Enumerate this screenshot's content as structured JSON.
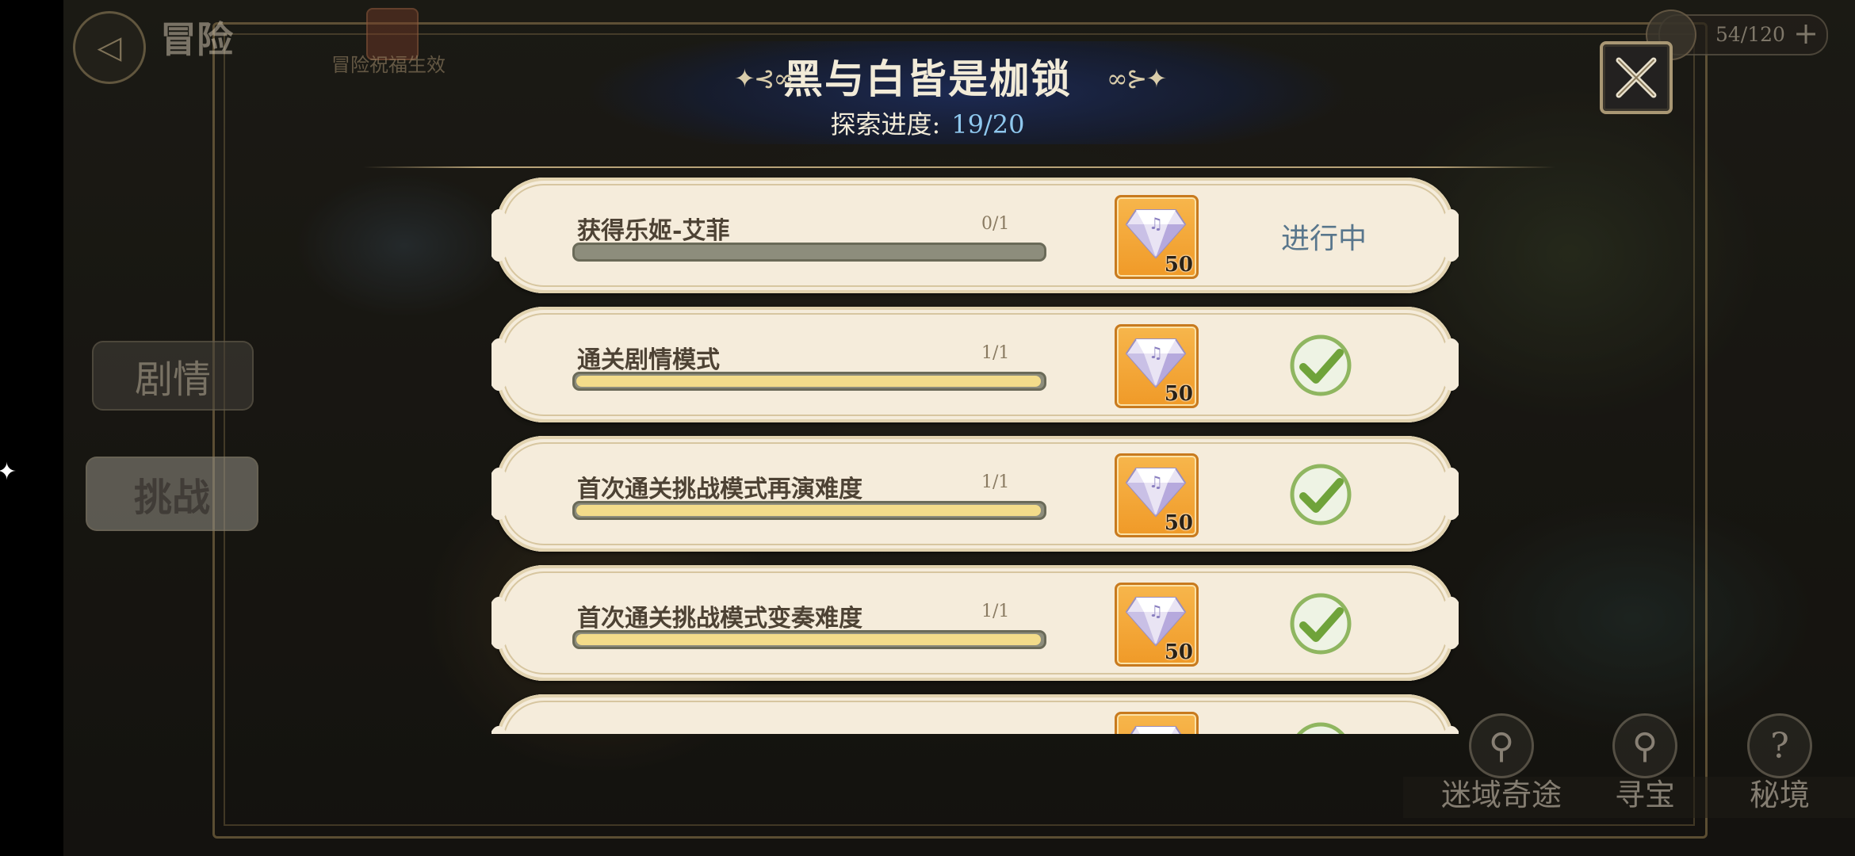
{
  "background": {
    "screen_title": "冒险",
    "buff_label": "冒险祝福生效",
    "stamina": "54/120",
    "stamina_plus": "+",
    "tabs": [
      {
        "label": "剧情"
      },
      {
        "label": "挑战"
      }
    ],
    "bottom_nav": [
      {
        "label": "迷域奇途",
        "icon": "map-pin-icon"
      },
      {
        "label": "寻宝",
        "icon": "treasure-key-icon"
      },
      {
        "label": "秘境",
        "icon": "question-icon"
      }
    ]
  },
  "dialog": {
    "title": "黑与白皆是枷锁",
    "progress_label": "探索进度:",
    "progress_value": "19/20",
    "colors": {
      "title": "#f2ebd8",
      "progress": "#8fc8ee",
      "in_progress": "#58768c",
      "check": "#6fa33a"
    }
  },
  "tasks": [
    {
      "name": "获得乐姬-艾菲",
      "count": "0/1",
      "progress": 0,
      "reward_icon": "diamond-icon",
      "reward_amount": "50",
      "status": "进行中",
      "done": false
    },
    {
      "name": "通关剧情模式",
      "count": "1/1",
      "progress": 1,
      "reward_icon": "diamond-icon",
      "reward_amount": "50",
      "status": "",
      "done": true
    },
    {
      "name": "首次通关挑战模式再演难度",
      "count": "1/1",
      "progress": 1,
      "reward_icon": "diamond-icon",
      "reward_amount": "50",
      "status": "",
      "done": true
    },
    {
      "name": "首次通关挑战模式变奏难度",
      "count": "1/1",
      "progress": 1,
      "reward_icon": "diamond-icon",
      "reward_amount": "50",
      "status": "",
      "done": true
    },
    {
      "name": "",
      "count": "",
      "progress": 1,
      "reward_icon": "diamond-icon",
      "reward_amount": "",
      "status": "",
      "done": true
    }
  ]
}
